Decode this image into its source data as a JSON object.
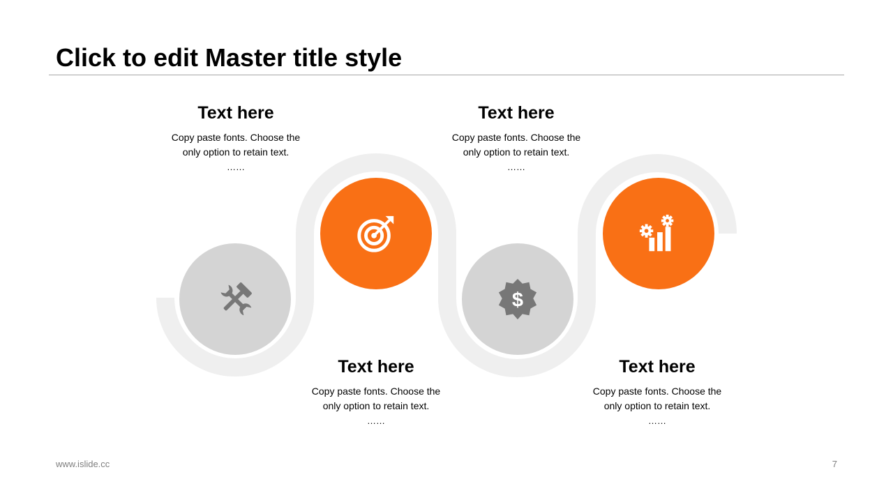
{
  "slide": {
    "title": "Click to edit Master title style",
    "footer_url": "www.islide.cc",
    "page_number": "7"
  },
  "colors": {
    "accent": "#f97015",
    "neutral_node": "#d4d4d4",
    "neutral_icon": "#777777",
    "track": "#efefef",
    "rule": "#a6a6a6"
  },
  "steps": [
    {
      "heading": "Text here",
      "body": "Copy paste fonts. Choose the only option to retain text.",
      "dots": "……",
      "icon": "tools-icon",
      "style": "neutral"
    },
    {
      "heading": "Text here",
      "body": "Copy paste fonts. Choose the only option to retain text.",
      "dots": "……",
      "icon": "target-icon",
      "style": "accent"
    },
    {
      "heading": "Text here",
      "body": "Copy paste fonts. Choose the only option to retain text.",
      "dots": "……",
      "icon": "dollar-badge-icon",
      "style": "neutral"
    },
    {
      "heading": "Text here",
      "body": "Copy paste fonts. Choose the only option to retain text.",
      "dots": "……",
      "icon": "growth-chart-icon",
      "style": "accent"
    }
  ]
}
